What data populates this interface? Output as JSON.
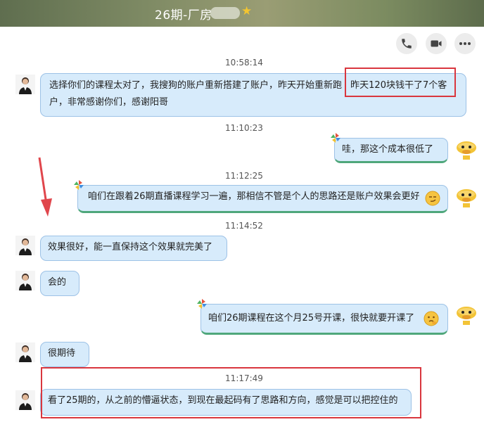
{
  "window": {
    "title": "26期-厂房"
  },
  "toolbar": {
    "call": "phone-icon",
    "video": "video-icon",
    "more": "more-icon"
  },
  "timestamps": [
    "10:58:14",
    "11:10:23",
    "11:12:25",
    "11:14:52",
    "11:17:49"
  ],
  "messages": [
    {
      "side": "left",
      "line1": "选择你们的课程太对了，我搜狗的账户重新搭建了账户，昨天开始重新跑",
      "highlight": "昨天120块钱干了7个客",
      "line2": "户，非常感谢你们，感谢阳哥"
    },
    {
      "side": "right",
      "text": "哇，那这个成本很低了"
    },
    {
      "side": "right",
      "text": "咱们在跟着26期直播课程学习一遍，那相信不管是个人的思路还是账户效果会更好"
    },
    {
      "side": "left",
      "text": "效果很好，能一直保持这个效果就完美了"
    },
    {
      "side": "left",
      "text": "会的"
    },
    {
      "side": "right",
      "text": "咱们26期课程在这个月25号开课，很快就要开课了"
    },
    {
      "side": "left",
      "text": "很期待"
    },
    {
      "side": "left",
      "text": "看了25期的，从之前的懵逼状态，到现在最起码有了思路和方向，感觉是可以把控住的"
    }
  ],
  "colors": {
    "bubble": "#d7ebfb",
    "bubble_border": "#9dc2e6",
    "highlight_box": "#d9363e",
    "arrow": "#e0464c"
  }
}
